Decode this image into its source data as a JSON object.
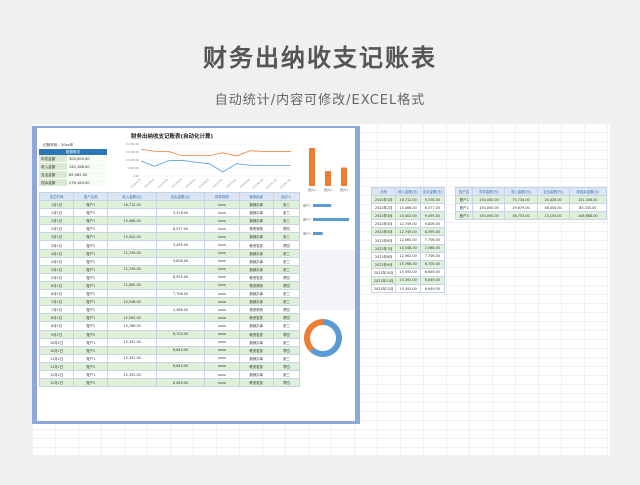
{
  "hero": {
    "title": "财务出纳收支记账表",
    "subtitle": "自动统计/内容可修改/EXCEL格式"
  },
  "sheet": {
    "title": "财务出纳收支记账表(自动化计算)",
    "year_label": "记账年份：",
    "year_value": "20xx年",
    "summary_header": "数据概览",
    "summary": [
      {
        "label": "年初金额",
        "value": "300,000.00"
      },
      {
        "label": "收入金额",
        "value": "142,166.00"
      },
      {
        "label": "支出金额",
        "value": "85,982.00"
      },
      {
        "label": "现余金额",
        "value": "276,184.00"
      }
    ],
    "ledger_headers": [
      "发生时间",
      "账户名称",
      "收入金额(元)",
      "支出金额(元)",
      "核算说明",
      "使用用途",
      "经办人"
    ],
    "ledger_rows": [
      [
        "1月1日",
        "账户1",
        "16,712.00",
        "",
        "xxxx",
        "报销办事",
        "张三"
      ],
      [
        "1月1日",
        "账户2",
        "",
        "9,378.00",
        "xxxx",
        "报销办事",
        "张三"
      ],
      [
        "2月1日",
        "账户1",
        "15,466.00",
        "",
        "xxxx",
        "报销办事",
        "张三"
      ],
      [
        "2月1日",
        "账户2",
        "",
        "6,077.00",
        "xxxx",
        "物资采购",
        "李四"
      ],
      [
        "3月1日",
        "账户1",
        "15,402.00",
        "",
        "xxxx",
        "报销办事",
        "张三"
      ],
      [
        "3月1日",
        "账户2",
        "",
        "9,495.00",
        "xxxx",
        "薪资发放",
        "李四"
      ],
      [
        "4月1日",
        "账户1",
        "12,749.00",
        "",
        "xxxx",
        "报销办事",
        "张三"
      ],
      [
        "4月1日",
        "账户2",
        "",
        "9,806.00",
        "xxxx",
        "报销办事",
        "张三"
      ],
      [
        "5月1日",
        "账户1",
        "12,749.00",
        "",
        "xxxx",
        "报销办事",
        "张三"
      ],
      [
        "5月1日",
        "账户2",
        "",
        "8,595.00",
        "xxxx",
        "薪资发放",
        "李四"
      ],
      [
        "6月1日",
        "账户1",
        "12,660.00",
        "",
        "xxxx",
        "物资采购",
        "李四"
      ],
      [
        "6月1日",
        "账户2",
        "",
        "7,706.00",
        "xxxx",
        "报销办事",
        "张三"
      ],
      [
        "7月1日",
        "账户1",
        "14,548.00",
        "",
        "xxxx",
        "报销办事",
        "张三"
      ],
      [
        "7月1日",
        "账户2",
        "",
        "2,566.00",
        "xxxx",
        "物资采购",
        "李四"
      ],
      [
        "8月1日",
        "账户1",
        "12,562.00",
        "",
        "xxxx",
        "薪资发放",
        "李四"
      ],
      [
        "8月1日",
        "账户2",
        "15,766.00",
        "",
        "xxxx",
        "报销办事",
        "张三"
      ],
      [
        "9月1日",
        "账户2",
        "",
        "6,700.00",
        "xxxx",
        "薪资发放",
        "李四"
      ],
      [
        "10月1日",
        "账户1",
        "15,392.00",
        "",
        "xxxx",
        "报销办事",
        "张三"
      ],
      [
        "10月1日",
        "账户2",
        "",
        "6,649.00",
        "xxxx",
        "薪资发放",
        "李四"
      ],
      [
        "11月1日",
        "账户1",
        "15,392.00",
        "",
        "xxxx",
        "报销办事",
        "张三"
      ],
      [
        "11月1日",
        "账户2",
        "",
        "6,649.00",
        "xxxx",
        "薪资发放",
        "李四"
      ],
      [
        "12月1日",
        "账户1",
        "15,392.00",
        "",
        "xxxx",
        "报销办事",
        "张三"
      ],
      [
        "12月1日",
        "账户2",
        "",
        "6,649.00",
        "xxxx",
        "薪资发放",
        "李四"
      ]
    ],
    "monthly_headers": [
      "月份",
      "收入金额(元)",
      "支出金额(元)"
    ],
    "monthly_rows": [
      [
        "2022年1月",
        "16,712.00",
        "9,378.00"
      ],
      [
        "2022年2月",
        "15,466.00",
        "6,077.00"
      ],
      [
        "2022年3月",
        "15,402.00",
        "9,495.00"
      ],
      [
        "2022年4月",
        "12,749.00",
        "9,806.00"
      ],
      [
        "2022年5月",
        "12,749.00",
        "8,595.00"
      ],
      [
        "2022年6月",
        "12,660.00",
        "7,706.00"
      ],
      [
        "2022年7月",
        "14,548.00",
        "2,566.00"
      ],
      [
        "2022年8月",
        "12,562.00",
        "7,706.00"
      ],
      [
        "2022年9月",
        "15,766.00",
        "6,700.00"
      ],
      [
        "2022年10月",
        "15,392.00",
        "6,649.00"
      ],
      [
        "2022年11月",
        "15,392.00",
        "6,649.00"
      ],
      [
        "2022年12月",
        "15,392.00",
        "6,649.00"
      ]
    ],
    "account_headers": [
      "账户名",
      "年初金额(元)",
      "收入金额(元)",
      "支出金额(元)",
      "现结余金额(元)"
    ],
    "account_rows": [
      [
        "账户1",
        "150,000.00",
        "75,734.00",
        "24,428.00",
        "151,306.00"
      ],
      [
        "账户2",
        "150,000.00",
        "29,679.00",
        "48,450.00",
        "84,333.00"
      ],
      [
        "账户3",
        "150,000.00",
        "36,753.00",
        "13,104.00",
        "108,688.00"
      ]
    ]
  },
  "chart_data": [
    {
      "type": "line",
      "title": "",
      "x": [
        "2022年1月",
        "2022年2月",
        "2022年3月",
        "2022年4月",
        "2022年5月",
        "2022年6月",
        "2022年7月",
        "2022年8月",
        "2022年9月",
        "2022年10月",
        "2022年11月",
        "2022年12月"
      ],
      "series": [
        {
          "values": [
            16712,
            15466,
            15402,
            12749,
            12749,
            12660,
            14548,
            12562,
            15766,
            15392,
            15392,
            15392
          ],
          "color": "#ed7d31"
        },
        {
          "values": [
            9378,
            6077,
            9495,
            9806,
            8595,
            7706,
            2566,
            7706,
            6700,
            6649,
            6649,
            6649
          ],
          "color": "#5b9bd5"
        }
      ],
      "ylim": [
        0,
        20000
      ],
      "yticks": [
        "20,000.00",
        "15,000.00",
        "10,000.00",
        "5,000.00",
        "0.00"
      ]
    },
    {
      "type": "bar",
      "categories": [
        "账户1",
        "账户2",
        "账户3"
      ],
      "values": [
        75734,
        29679,
        36753
      ],
      "color": "#ed7d31"
    },
    {
      "type": "bar",
      "orientation": "horizontal",
      "categories": [
        "账户1",
        "账户2",
        "账户3"
      ],
      "values": [
        24428,
        48450,
        13104
      ],
      "color": "#5b9bd5"
    },
    {
      "type": "pie",
      "variant": "donut",
      "values": [
        142166,
        85982
      ],
      "colors": [
        "#5b9bd5",
        "#ed7d31"
      ]
    }
  ]
}
